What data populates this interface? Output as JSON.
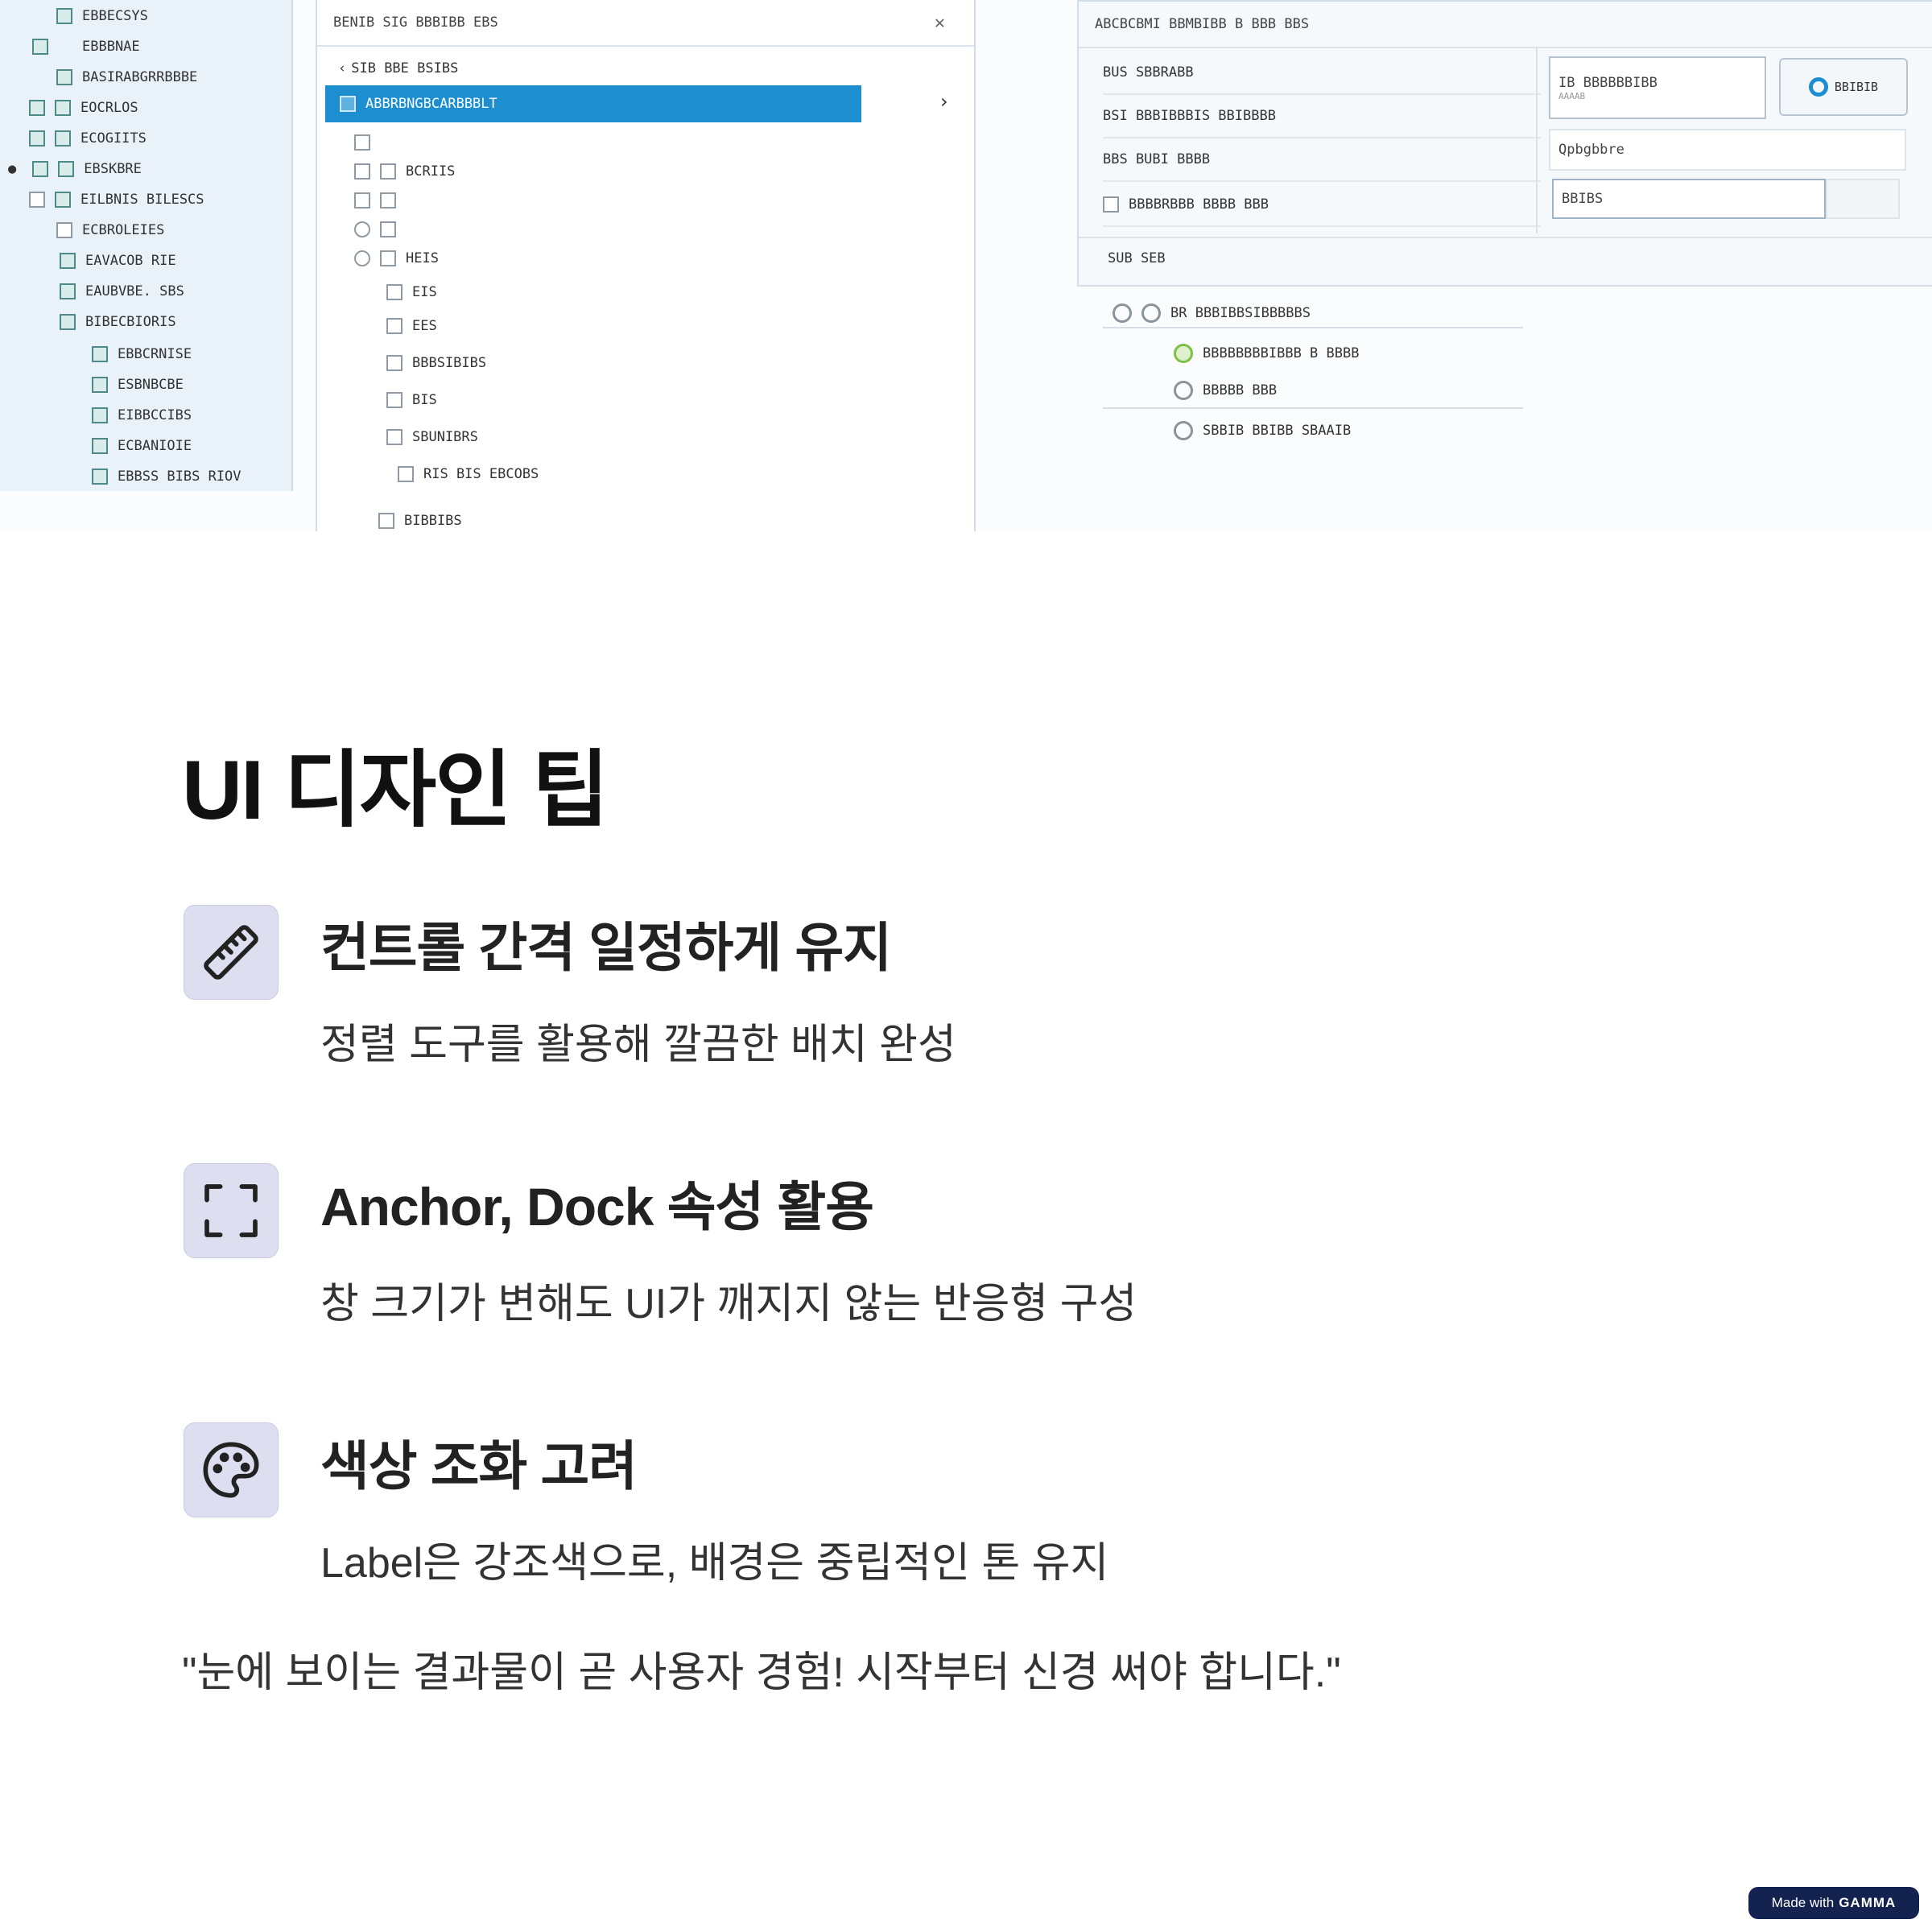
{
  "screenshot": {
    "tree_items": [
      "EBBECSYS",
      "EBBBNAE",
      "BASIRABGRRBBBE",
      "EOCRLOS",
      "ECOGIITS",
      "EBSKBRE",
      "EILBNIS BILESCS",
      "ECBROLEIES",
      "EAVACOB RIE",
      "EAUBVBE. SBS",
      "BIBECBIORIS",
      "EBBCRNISE",
      "ESBNBCBE",
      "EIBBCCIBS",
      "ECBANIOIE",
      "EBBSS BIBS RIOV"
    ],
    "middle_header": "BENIB SIG BBBIBB EBS",
    "middle_subheader": "SIB BBE BSIBS",
    "selected_item": "ABBRBNGBCARBBBLT",
    "middle_items": [
      "BCRIIS",
      "HEIS",
      "EIS",
      "EES",
      "BBBSIBIBS",
      "BIS",
      "SBUNIBRS",
      "RIS BIS EBCOBS",
      "BIBBIBS"
    ],
    "right_header": "ABCBCBMI BBMBIBB B BBB BBS",
    "form_rows": [
      "BUS SBBRABB",
      "BSI BBBIBBBIS BBIBBBB",
      "BBS BUBI BBBB",
      "BBBBRBBB BBBB BBB"
    ],
    "open_button": "BBIBIB",
    "file_box_line1": "IB BBBBBBIBB",
    "file_box_line2": "AAAAB",
    "category_box": "Qpbgbbre",
    "value_box": "BBIBS",
    "summary_label": "SUB SEB",
    "option_group": "BR BBBIBBSIBBBBBS",
    "options": [
      "BBBBBBBBIBBB B BBBB",
      "BBBBB BBB",
      "SBBIB BBIBB SBAAIB"
    ]
  },
  "title": "UI 디자인 팁",
  "tips": [
    {
      "icon": "ruler-icon",
      "heading": "컨트롤 간격 일정하게 유지",
      "desc": "정렬 도구를 활용해 깔끔한 배치 완성"
    },
    {
      "icon": "expand-icon",
      "heading": "Anchor, Dock 속성 활용",
      "desc": "창 크기가 변해도 UI가 깨지지 않는 반응형 구성"
    },
    {
      "icon": "palette-icon",
      "heading": "색상 조화 고려",
      "desc": "Label은 강조색으로, 배경은 중립적인 톤 유지"
    }
  ],
  "quote": "\"눈에 보이는 결과물이 곧 사용자 경험! 시작부터 신경 써야 합니다.\"",
  "badge": {
    "prefix": "Made with",
    "brand": "GAMMA"
  },
  "colors": {
    "accent": "#1d8fd1",
    "icon_bg": "#dddff0",
    "badge_bg": "#13224e"
  }
}
